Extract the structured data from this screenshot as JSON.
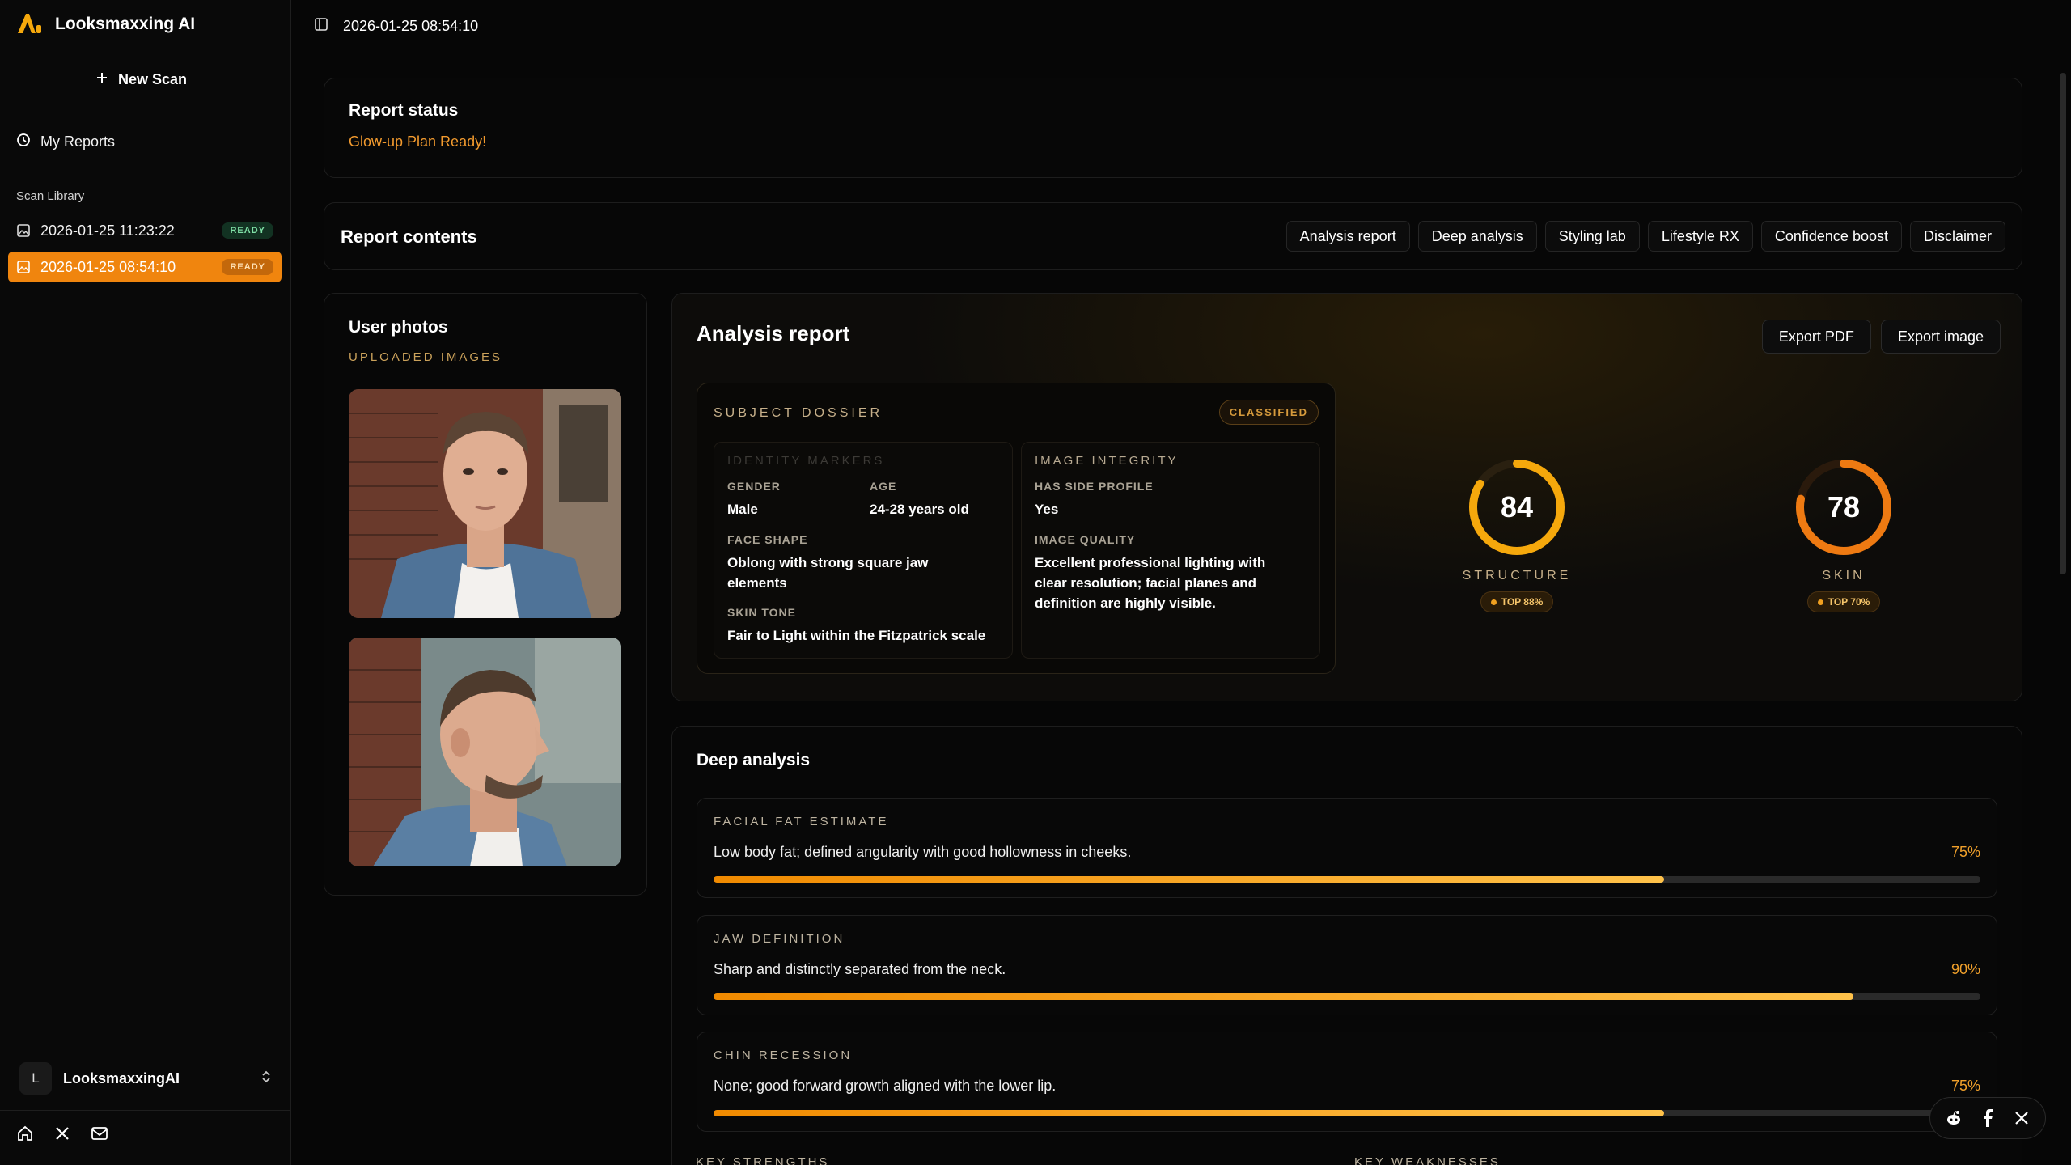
{
  "app": {
    "name": "Looksmaxxing AI"
  },
  "sidebar": {
    "new_scan_label": "New Scan",
    "my_reports_label": "My Reports",
    "library_label": "Scan Library",
    "scans": [
      {
        "label": "2026-01-25 11:23:22",
        "badge": "READY",
        "active": false
      },
      {
        "label": "2026-01-25 08:54:10",
        "badge": "READY",
        "active": true
      }
    ],
    "user": {
      "initial": "L",
      "name": "LooksmaxxingAI"
    }
  },
  "header": {
    "title": "2026-01-25 08:54:10"
  },
  "report_status": {
    "title": "Report status",
    "text": "Glow-up Plan Ready!"
  },
  "report_contents": {
    "title": "Report contents",
    "tabs": [
      "Analysis report",
      "Deep analysis",
      "Styling lab",
      "Lifestyle RX",
      "Confidence boost",
      "Disclaimer"
    ]
  },
  "user_photos": {
    "title": "User photos",
    "subtitle": "UPLOADED IMAGES"
  },
  "analysis": {
    "title": "Analysis report",
    "export_pdf": "Export PDF",
    "export_image": "Export image",
    "dossier": {
      "title": "SUBJECT DOSSIER",
      "badge": "CLASSIFIED",
      "identity": {
        "heading": "IDENTITY MARKERS",
        "gender_label": "GENDER",
        "gender": "Male",
        "age_label": "AGE",
        "age": "24-28 years old",
        "face_shape_label": "FACE SHAPE",
        "face_shape": "Oblong with strong square jaw elements",
        "skin_tone_label": "SKIN TONE",
        "skin_tone": "Fair to Light within the Fitzpatrick scale"
      },
      "integrity": {
        "heading": "IMAGE INTEGRITY",
        "side_profile_label": "HAS SIDE PROFILE",
        "side_profile": "Yes",
        "quality_label": "IMAGE QUALITY",
        "quality": "Excellent professional lighting with clear resolution; facial planes and definition are highly visible."
      }
    },
    "scores": [
      {
        "value": "84",
        "label": "STRUCTURE",
        "rank": "TOP 88%",
        "color": "#f5a80c"
      },
      {
        "value": "78",
        "label": "SKIN",
        "rank": "TOP 70%",
        "color": "#ee7a12"
      }
    ]
  },
  "deep": {
    "title": "Deep analysis",
    "metrics": [
      {
        "label": "FACIAL FAT ESTIMATE",
        "desc": "Low body fat; defined angularity with good hollowness in cheeks.",
        "pct": "75%",
        "value": 75
      },
      {
        "label": "JAW DEFINITION",
        "desc": "Sharp and distinctly separated from the neck.",
        "pct": "90%",
        "value": 90
      },
      {
        "label": "CHIN RECESSION",
        "desc": "None; good forward growth aligned with the lower lip.",
        "pct": "75%",
        "value": 75
      }
    ],
    "key_strengths": "KEY STRENGTHS",
    "key_weaknesses": "KEY WEAKNESSES"
  }
}
